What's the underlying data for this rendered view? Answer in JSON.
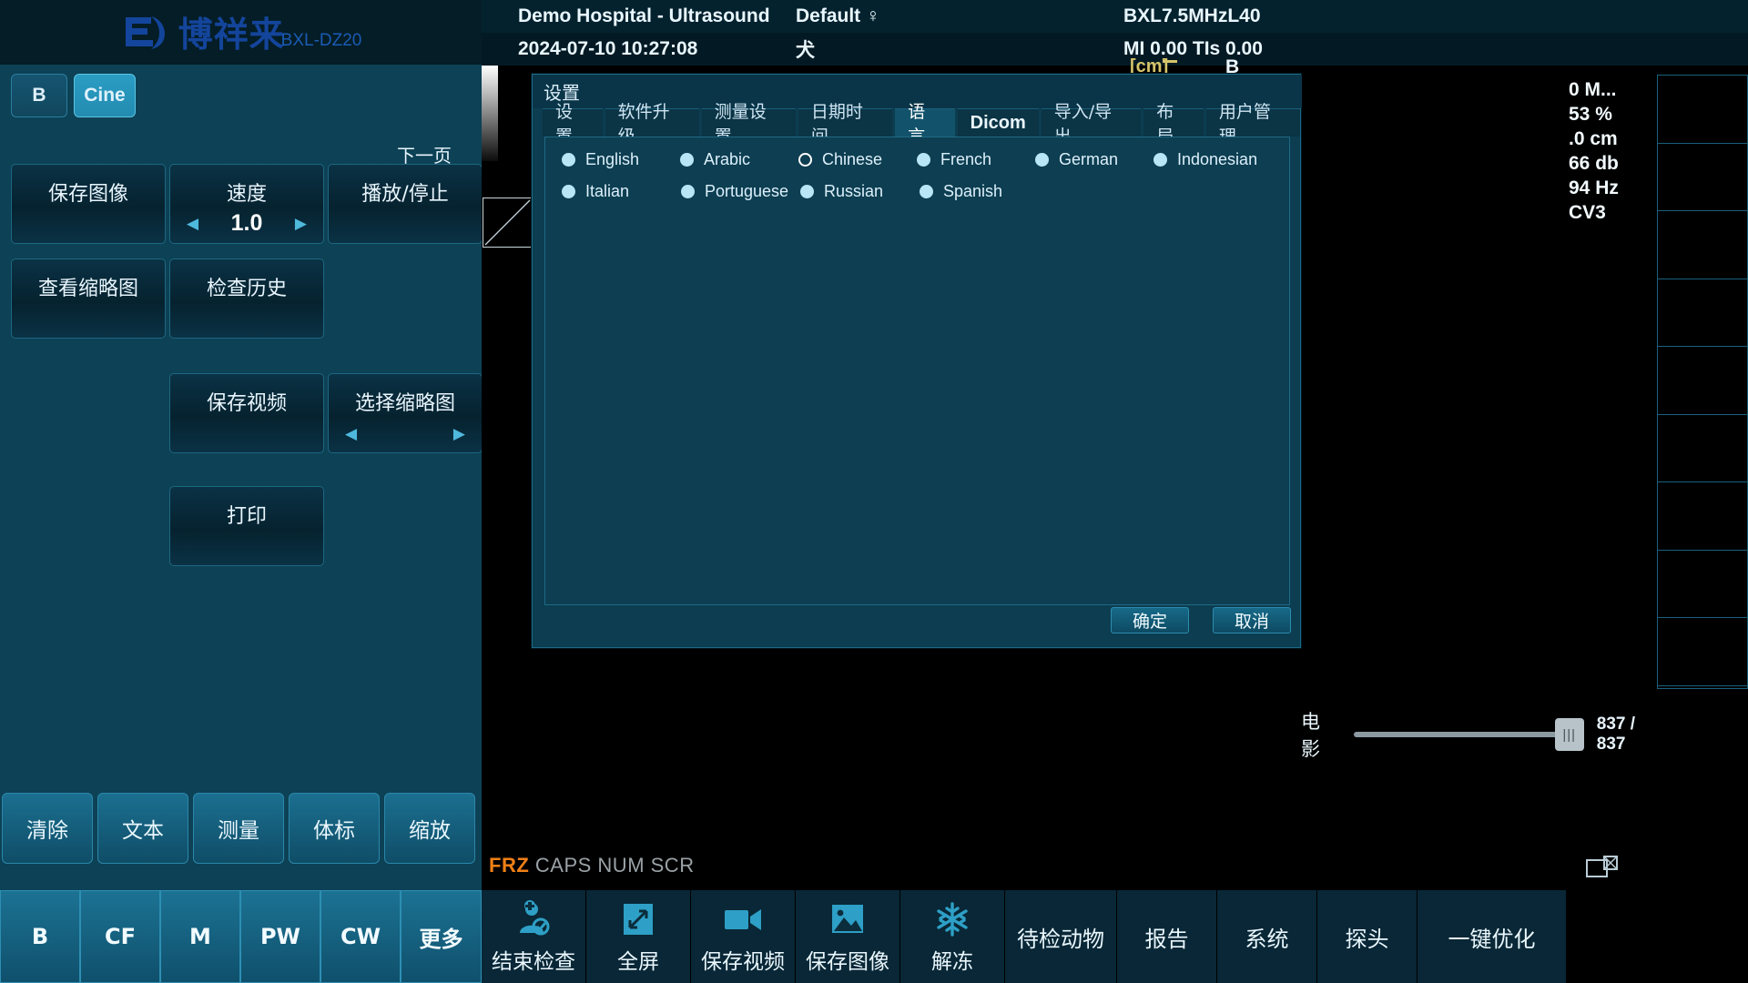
{
  "brand": {
    "name_cn": "博祥来",
    "model": "BXL-DZ20",
    "logo_icon": "bxl-logo-icon"
  },
  "left_panel": {
    "mode_tabs": [
      {
        "label": "B",
        "active": false
      },
      {
        "label": "Cine",
        "active": true
      }
    ],
    "next_page_label": "下一页",
    "function_buttons": [
      {
        "label": "保存图像",
        "type": "plain"
      },
      {
        "label": "速度",
        "type": "spinner",
        "value": "1.0"
      },
      {
        "label": "播放/停止",
        "type": "plain"
      },
      {
        "label": "查看缩略图",
        "type": "plain"
      },
      {
        "label": "检查历史",
        "type": "plain"
      },
      {
        "label": "保存视频",
        "type": "plain"
      },
      {
        "label": "选择缩略图",
        "type": "arrows"
      },
      {
        "label": "打印",
        "type": "plain"
      }
    ],
    "tool_buttons": [
      "清除",
      "文本",
      "测量",
      "体标",
      "缩放"
    ],
    "mode_buttons": [
      "B",
      "CF",
      "M",
      "PW",
      "CW",
      "更多"
    ]
  },
  "display": {
    "header": {
      "hospital": "Demo Hospital - Ultrasound",
      "preset": "Default ♀",
      "probe": "BXL7.5MHzL40",
      "datetime": "2024-07-10 10:27:08",
      "species": "犬",
      "acoustic": "MI 0.00 TIs 0.00"
    },
    "depth_unit": "[cm]",
    "mode_letter": "B",
    "parameters": [
      "0 M...",
      "53 %",
      ".0 cm",
      "66 db",
      "94 Hz",
      "CV3"
    ],
    "cine": {
      "label": "电影",
      "frame_counter": "837 / 837",
      "thumb_icon": "slider-handle-icon"
    },
    "status": {
      "frz": "FRZ",
      "indicators": "CAPS NUM SCR",
      "frz_color": "#f28016"
    },
    "split_screen_icon": "split-screen-icon",
    "battery_icon": "battery-icon",
    "equalizer_icon": "equalizer-icon"
  },
  "bottom_nav": [
    {
      "label": "结束检查",
      "icon": "end-exam-icon"
    },
    {
      "label": "全屏",
      "icon": "fullscreen-icon"
    },
    {
      "label": "保存视频",
      "icon": "save-video-icon"
    },
    {
      "label": "保存图像",
      "icon": "save-image-icon"
    },
    {
      "label": "解冻",
      "icon": "unfreeze-icon"
    },
    {
      "label": "待检动物",
      "icon": ""
    },
    {
      "label": "报告",
      "icon": ""
    },
    {
      "label": "系统",
      "icon": ""
    },
    {
      "label": "探头",
      "icon": ""
    },
    {
      "label": "一键优化",
      "icon": ""
    }
  ],
  "dialog": {
    "title": "设置",
    "tabs": [
      {
        "label": "设置",
        "active": false,
        "latin": false
      },
      {
        "label": "软件升级",
        "active": false,
        "latin": false
      },
      {
        "label": "测量设置",
        "active": false,
        "latin": false
      },
      {
        "label": "日期时间",
        "active": false,
        "latin": false
      },
      {
        "label": "语言",
        "active": true,
        "latin": false
      },
      {
        "label": "Dicom",
        "active": false,
        "latin": true
      },
      {
        "label": "导入/导出",
        "active": false,
        "latin": false
      },
      {
        "label": "布局",
        "active": false,
        "latin": false
      },
      {
        "label": "用户管理",
        "active": false,
        "latin": false
      }
    ],
    "languages": [
      [
        {
          "label": "English",
          "selected": false
        },
        {
          "label": "Arabic",
          "selected": false
        },
        {
          "label": "Chinese",
          "selected": true
        },
        {
          "label": "French",
          "selected": false
        },
        {
          "label": "German",
          "selected": false
        },
        {
          "label": "Indonesian",
          "selected": false
        }
      ],
      [
        {
          "label": "Italian",
          "selected": false
        },
        {
          "label": "Portuguese",
          "selected": false
        },
        {
          "label": "Russian",
          "selected": false
        },
        {
          "label": "Spanish",
          "selected": false
        }
      ]
    ],
    "ok_label": "确定",
    "cancel_label": "取消"
  },
  "colors": {
    "panel_bg": "#0d4155",
    "accent": "#2b9dc4",
    "dialog_bg": "#0d3e51",
    "warning": "#f28016",
    "depth_label": "#d6c46a"
  }
}
